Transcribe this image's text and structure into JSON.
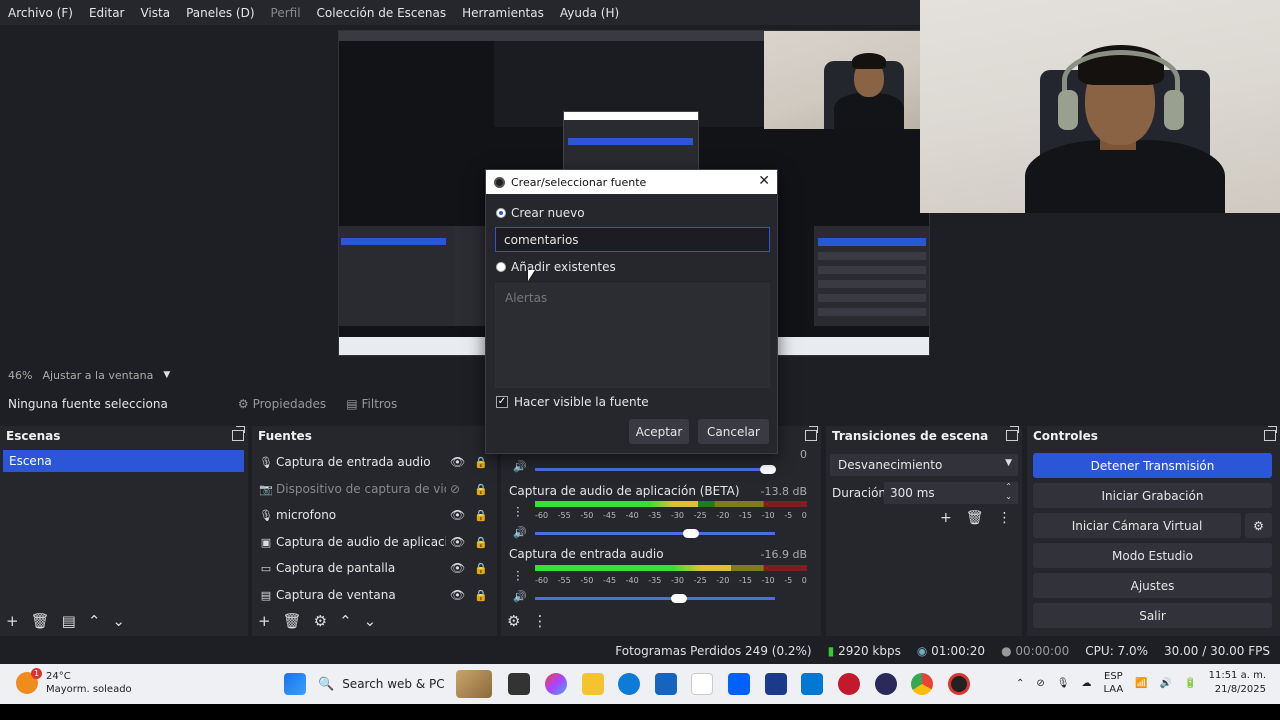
{
  "menu": [
    "Archivo (F)",
    "Editar",
    "Vista",
    "Paneles (D)",
    "Perfil",
    "Colección de Escenas",
    "Herramientas",
    "Ayuda (H)"
  ],
  "preview": {
    "zoom": "46%",
    "fit_label": "Ajustar a la ventana"
  },
  "source_bar": {
    "no_source": "Ninguna fuente selecciona",
    "properties": "Propiedades",
    "filters": "Filtros"
  },
  "scenes": {
    "title": "Escenas",
    "items": [
      "Escena"
    ]
  },
  "sources": {
    "title": "Fuentes",
    "items": [
      {
        "name": "Captura de entrada audio",
        "icon": "microphone-icon",
        "visible": true
      },
      {
        "name": "Dispositivo de captura de video",
        "icon": "camera-icon",
        "visible": false
      },
      {
        "name": "microfono",
        "icon": "microphone-icon",
        "visible": true
      },
      {
        "name": "Captura de audio de aplicación (BETA)",
        "icon": "app-audio-icon",
        "visible": true
      },
      {
        "name": "Captura de pantalla",
        "icon": "monitor-icon",
        "visible": true
      },
      {
        "name": "Captura de ventana",
        "icon": "window-icon",
        "visible": true
      }
    ]
  },
  "mixer": {
    "channels": [
      {
        "name": "Captura de audio de aplicación (BETA)",
        "db": "-13.8 dB",
        "level": 0.6,
        "volume": 0.65
      },
      {
        "name": "Captura de entrada audio",
        "db": "-16.9 dB",
        "level": 0.72,
        "volume": 0.6
      }
    ],
    "top_volume": 0.97,
    "scale": [
      "-60",
      "-55",
      "-50",
      "-45",
      "-40",
      "-35",
      "-30",
      "-25",
      "-20",
      "-15",
      "-10",
      "-5",
      "0"
    ]
  },
  "transitions": {
    "title": "Transiciones de escena",
    "selected": "Desvanecimiento",
    "duration_label": "Duración",
    "duration_value": "300 ms"
  },
  "controls": {
    "title": "Controles",
    "buttons": [
      "Detener Transmisión",
      "Iniciar Grabación",
      "Iniciar Cámara Virtual",
      "Modo Estudio",
      "Ajustes",
      "Salir"
    ]
  },
  "status": {
    "dropped": "Fotogramas Perdidos 249 (0.2%)",
    "bitrate": "2920 kbps",
    "stream_time": "01:00:20",
    "rec_time": "00:00:00",
    "cpu": "CPU: 7.0%",
    "fps": "30.00 / 30.00 FPS"
  },
  "dialog": {
    "title": "Crear/seleccionar fuente",
    "create_new": "Crear nuevo",
    "name_value": "comentarios",
    "add_existing": "Añadir existentes",
    "existing_items": [
      "Alertas"
    ],
    "make_visible": "Hacer visible la fuente",
    "ok": "Aceptar",
    "cancel": "Cancelar"
  },
  "taskbar": {
    "weather_temp": "24°C",
    "weather_desc": "Mayorm. soleado",
    "weather_badge": "1",
    "search": "Search web & PC",
    "lang": "ESP",
    "layout": "LAA",
    "time": "11:51 a. m.",
    "date": "21/8/2025"
  },
  "colors": {
    "accent": "#2b56d8",
    "panel": "#26272d",
    "background": "#1e1f24"
  }
}
